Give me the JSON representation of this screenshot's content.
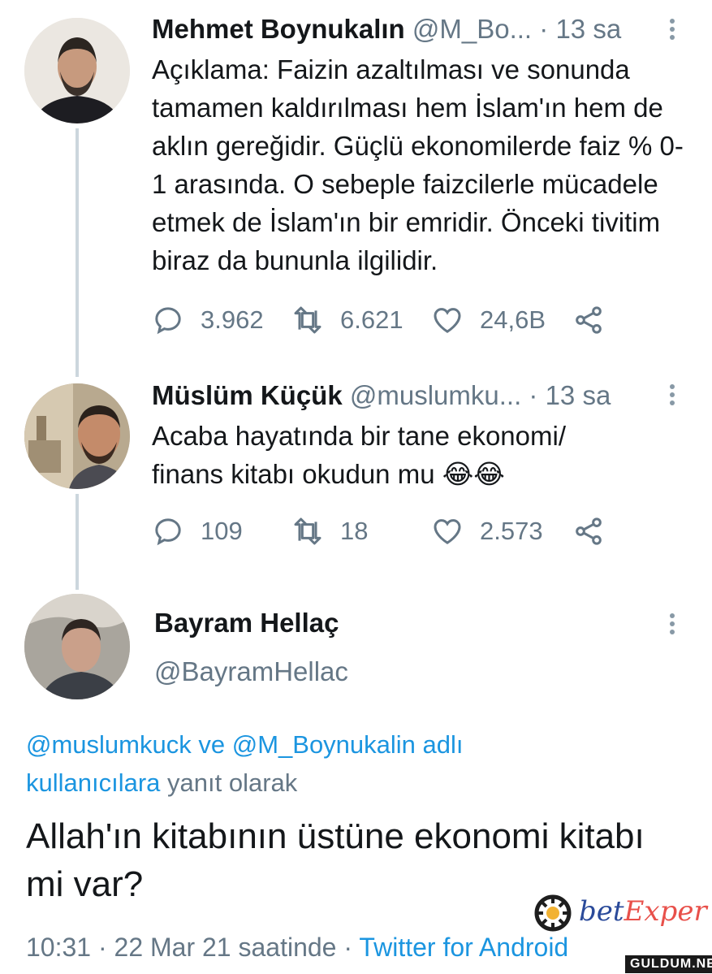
{
  "tweets": [
    {
      "name": "Mehmet Boynukalın",
      "handle": "@M_Bo...",
      "time": "· 13 sa",
      "text": "Açıklama: Faizin azaltılması ve sonunda tamamen kaldırılması hem İslam'ın hem de aklın gereğidir. Güçlü ekonomilerde faiz % 0-1 arasında. O sebeple faizcilerle mücadele etmek de İslam'ın bir emridir. Önceki tivitim biraz da bununla ilgilidir.",
      "replies": "3.962",
      "retweets": "6.621",
      "likes": "24,6B"
    },
    {
      "name": "Müslüm Küçük",
      "handle": "@muslumku...",
      "time": "· 13 sa",
      "text": "Acaba hayatında bir tane ekonomi/ finans kitabı okudun mu 😂😂",
      "replies": "109",
      "retweets": "18",
      "likes": "2.573"
    }
  ],
  "main": {
    "name": "Bayram Hellaç",
    "handle": "@BayramHellac",
    "reply_users_1": "@muslumkuck",
    "reply_and": "ve",
    "reply_users_2": "@M_Boynukalin adlı",
    "reply_users_3": "kullanıcılara",
    "reply_suffix": "yanıt olarak",
    "text": "Allah'ın kitabının üstüne ekonomi kitabı mi var?",
    "timestamp": "10:31 · 22 Mar 21 saatinde ·",
    "source": "Twitter for Android"
  },
  "watermark": {
    "logo_prefix": "bet",
    "logo_suffix": "Exper",
    "site": "GULDUM.NET"
  },
  "colors": {
    "link": "#1b95e0",
    "secondary_text": "#657786",
    "thread_line": "#ccd6dd"
  }
}
